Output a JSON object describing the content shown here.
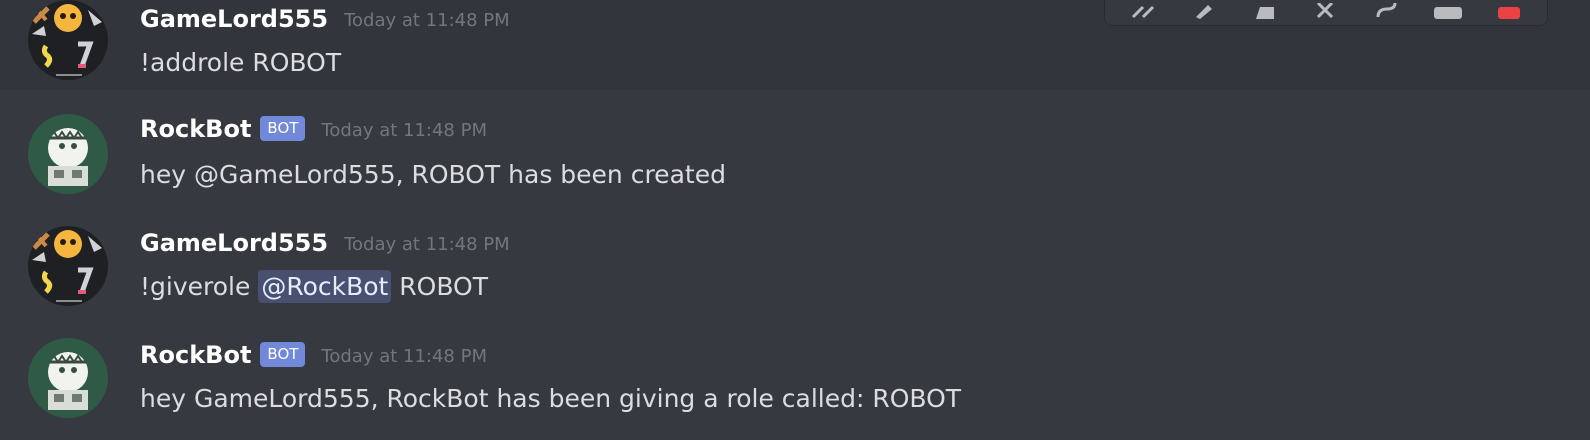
{
  "messages": [
    {
      "author": "GameLord555",
      "is_bot": false,
      "timestamp": "Today at 11:48 PM",
      "content": "!addrole ROBOT",
      "avatar": "gamelord-avatar"
    },
    {
      "author": "RockBot",
      "is_bot": true,
      "bot_tag": "BOT",
      "timestamp": "Today at 11:48 PM",
      "content": "hey @GameLord555, ROBOT has been created",
      "avatar": "rockbot-avatar"
    },
    {
      "author": "GameLord555",
      "is_bot": false,
      "timestamp": "Today at 11:48 PM",
      "content_before": "!giverole",
      "mention": "@RockBot",
      "content_after": "ROBOT",
      "avatar": "gamelord-avatar"
    },
    {
      "author": "RockBot",
      "is_bot": true,
      "bot_tag": "BOT",
      "timestamp": "Today at 11:48 PM",
      "content": "hey GameLord555, RockBot has been giving a role called: ROBOT",
      "avatar": "rockbot-avatar"
    }
  ],
  "toolbar": {
    "icons": [
      "reply-icon",
      "edit-icon",
      "reaction-icon",
      "mute-icon",
      "link-icon",
      "more-icon",
      "delete-icon"
    ]
  },
  "colors": {
    "background": "#36393f",
    "hover_background": "#32353b",
    "bot_tag": "#7289da",
    "username": "#ffffff",
    "text": "#dcddde",
    "timestamp": "#72767d",
    "danger": "#ed4245"
  }
}
